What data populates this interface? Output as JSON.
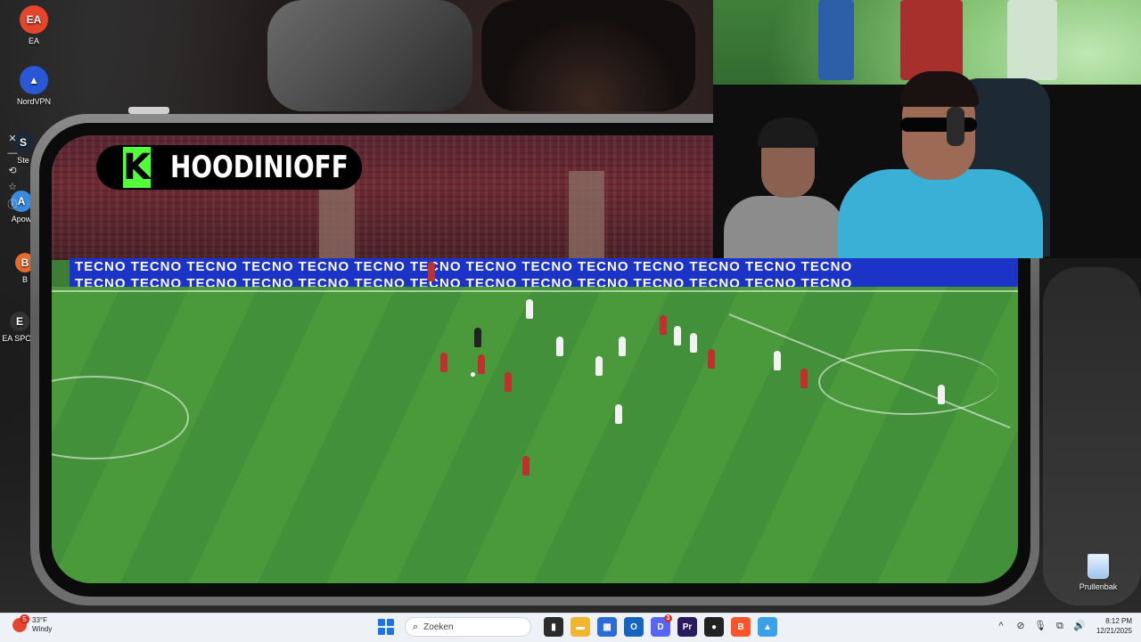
{
  "desktop": {
    "icons": [
      {
        "label": "EA",
        "color": "#e4452c",
        "glyph": "EA"
      },
      {
        "label": "NordVPN",
        "color": "#2a57d6",
        "glyph": "▲"
      },
      {
        "label": "Ste",
        "color": "#1b2838",
        "glyph": "S"
      },
      {
        "label": "Apow",
        "color": "#3a8be0",
        "glyph": "A"
      },
      {
        "label": "B",
        "color": "#e86a2c",
        "glyph": "B"
      },
      {
        "label": "EA SPOR",
        "color": "#333333",
        "glyph": "E"
      }
    ],
    "side_controls": [
      "✕",
      "—",
      "⟲",
      "☆",
      "ⓘ"
    ],
    "recycle_bin": {
      "label": "Prullenbak"
    }
  },
  "video": {
    "channel_logo": "K",
    "channel_name": "HOODINIOFF",
    "ad_text": "TECNO TECNO TECNO TECNO TECNO TECNO TECNO TECNO TECNO TECNO TECNO TECNO TECNO TECNO",
    "ad_text_2": "TECNO TECNO TECNO TECNO TECNO TECNO TECNO TECNO TECNO TECNO TECNO TECNO TECNO TECNO"
  },
  "taskbar": {
    "weather": {
      "temp": "33°F",
      "condition": "Windy",
      "badge": "5"
    },
    "search_placeholder": "Zoeken",
    "apps": [
      {
        "name": "task-view",
        "color": "#2b2b2b",
        "glyph": "▮"
      },
      {
        "name": "file-explorer",
        "color": "#f2b530",
        "glyph": "▬"
      },
      {
        "name": "store",
        "color": "#2b6cd6",
        "glyph": "▦"
      },
      {
        "name": "outlook",
        "color": "#1565c0",
        "glyph": "O"
      },
      {
        "name": "discord",
        "color": "#5865f2",
        "glyph": "D",
        "badge": "3"
      },
      {
        "name": "premiere",
        "color": "#2a1a5e",
        "glyph": "Pr"
      },
      {
        "name": "obs",
        "color": "#222222",
        "glyph": "●"
      },
      {
        "name": "brave",
        "color": "#fb542b",
        "glyph": "B"
      },
      {
        "name": "photos",
        "color": "#3aa0e8",
        "glyph": "▲"
      }
    ],
    "tray_icons": [
      "^",
      "⊘",
      "🎙",
      "⧉",
      "🔊"
    ],
    "time": "8:12 PM",
    "date": "12/21/2025"
  }
}
